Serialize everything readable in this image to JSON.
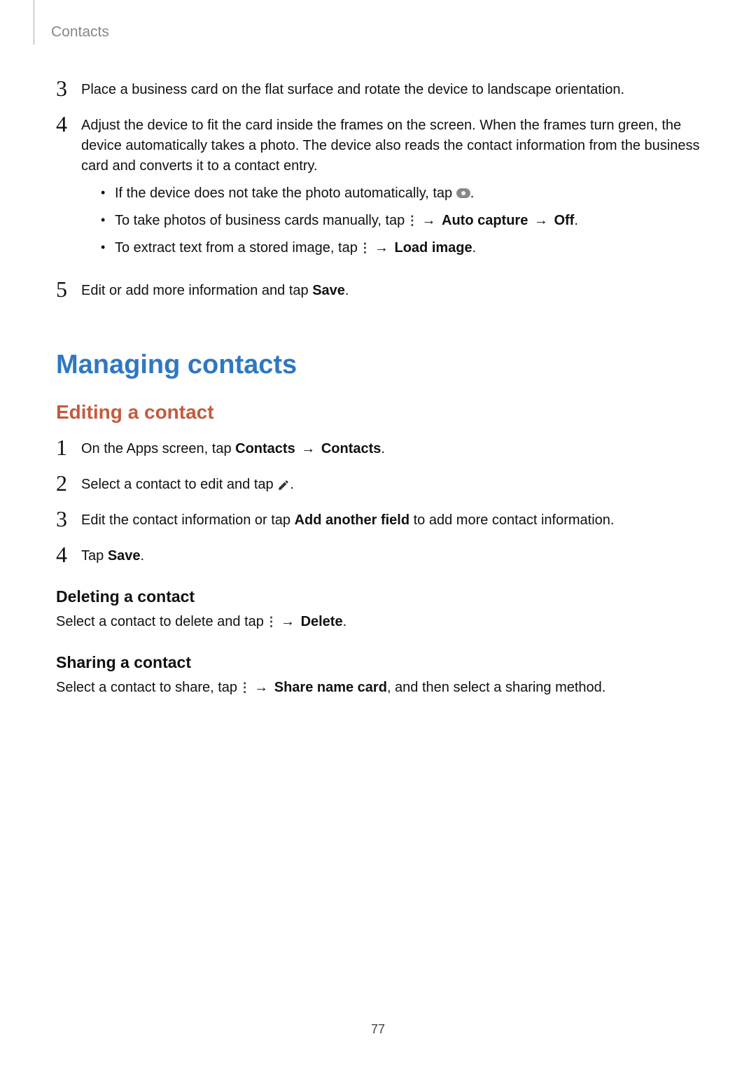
{
  "header": {
    "section": "Contacts"
  },
  "steps_top": {
    "s3": {
      "num": "3",
      "text": "Place a business card on the flat surface and rotate the device to landscape orientation."
    },
    "s4": {
      "num": "4",
      "intro": "Adjust the device to fit the card inside the frames on the screen. When the frames turn green, the device automatically takes a photo. The device also reads the contact information from the business card and converts it to a contact entry.",
      "b1_pre": "If the device does not take the photo automatically, tap ",
      "b1_post": ".",
      "b2_pre": "To take photos of business cards manually, tap ",
      "b2_bold1": "Auto capture",
      "b2_bold2": "Off",
      "b2_post": ".",
      "b3_pre": "To extract text from a stored image, tap ",
      "b3_bold": "Load image",
      "b3_post": "."
    },
    "s5": {
      "num": "5",
      "pre": "Edit or add more information and tap ",
      "bold": "Save",
      "post": "."
    }
  },
  "h1": "Managing contacts",
  "h2": "Editing a contact",
  "edit_steps": {
    "s1": {
      "num": "1",
      "pre": "On the Apps screen, tap ",
      "b1": "Contacts",
      "b2": "Contacts",
      "post": "."
    },
    "s2": {
      "num": "2",
      "pre": "Select a contact to edit and tap ",
      "post": "."
    },
    "s3": {
      "num": "3",
      "pre": "Edit the contact information or tap ",
      "bold": "Add another field",
      "post": " to add more contact information."
    },
    "s4": {
      "num": "4",
      "pre": "Tap ",
      "bold": "Save",
      "post": "."
    }
  },
  "deleting": {
    "title": "Deleting a contact",
    "pre": "Select a contact to delete and tap ",
    "bold": "Delete",
    "post": "."
  },
  "sharing": {
    "title": "Sharing a contact",
    "pre": "Select a contact to share, tap ",
    "bold": "Share name card",
    "post": ", and then select a sharing method."
  },
  "arrow": "→",
  "pagenum": "77"
}
